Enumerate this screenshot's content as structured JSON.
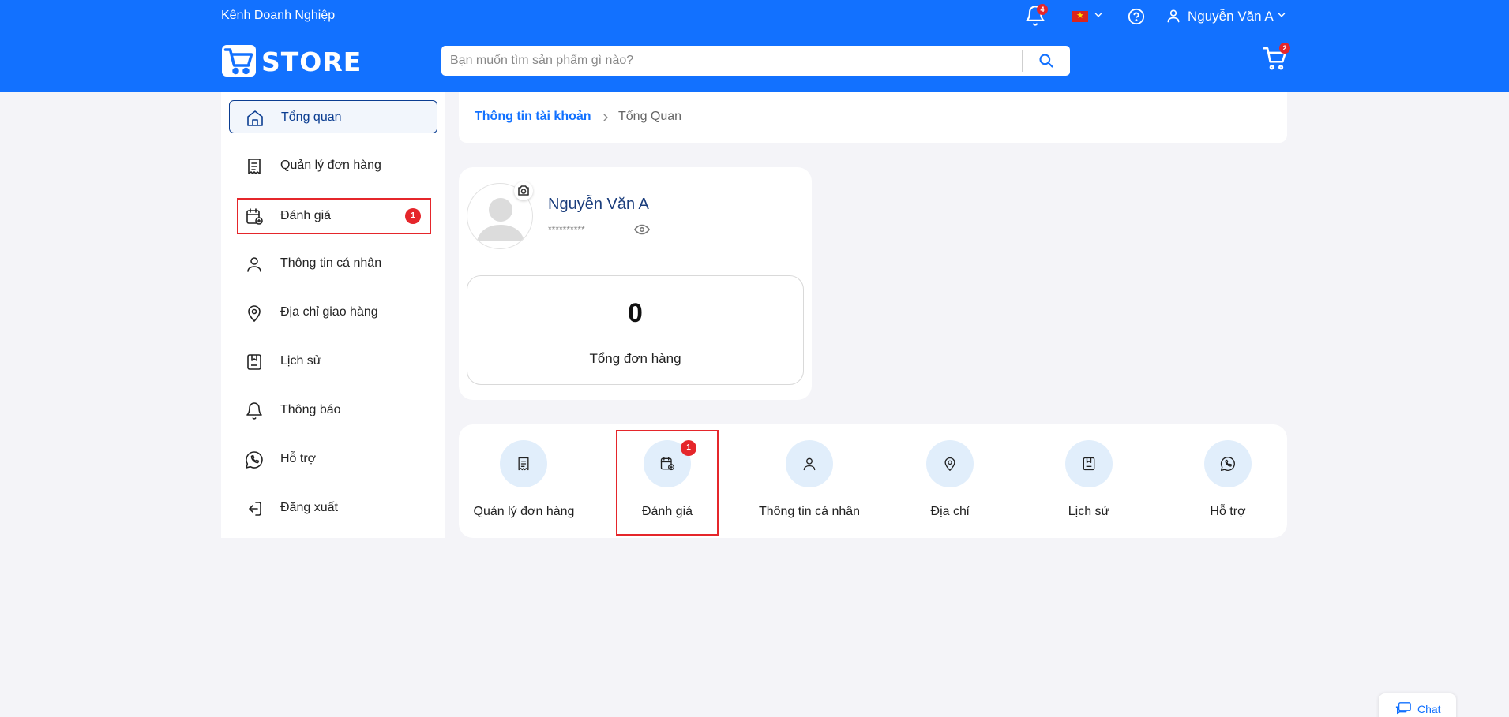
{
  "header": {
    "business_link": "Kênh Doanh Nghiệp",
    "notification_count": "4",
    "language_flag": "vietnam-flag",
    "user_name": "Nguyễn Văn A",
    "brand_color": "#1271ff",
    "logo_text": "STORE",
    "search_placeholder": "Bạn muốn tìm sản phẩm gì nào?",
    "cart_count": "2"
  },
  "sidebar": {
    "items": [
      {
        "label": "Tổng quan",
        "icon": "home-icon",
        "active": true
      },
      {
        "label": "Quản lý đơn hàng",
        "icon": "receipt-icon"
      },
      {
        "label": "Đánh giá",
        "icon": "calendar-review-icon",
        "badge": "1",
        "highlighted": true
      },
      {
        "label": "Thông tin cá nhân",
        "icon": "user-icon"
      },
      {
        "label": "Địa chỉ giao hàng",
        "icon": "location-pin-icon"
      },
      {
        "label": "Lịch sử",
        "icon": "history-bookmark-icon"
      },
      {
        "label": "Thông báo",
        "icon": "bell-icon"
      },
      {
        "label": "Hỗ trợ",
        "icon": "phone-support-icon"
      },
      {
        "label": "Đăng xuất",
        "icon": "logout-icon"
      }
    ]
  },
  "breadcrumb": {
    "parent": "Thông tin tài khoản",
    "current": "Tổng Quan"
  },
  "profile": {
    "name": "Nguyễn Văn A",
    "masked_password": "**********",
    "total_orders": "0",
    "total_orders_label": "Tổng đơn hàng"
  },
  "shortcuts": [
    {
      "label": "Quản lý đơn hàng",
      "icon": "receipt-icon"
    },
    {
      "label": "Đánh giá",
      "icon": "calendar-review-icon",
      "badge": "1",
      "highlighted": true
    },
    {
      "label": "Thông tin cá nhân",
      "icon": "user-icon"
    },
    {
      "label": "Địa chỉ",
      "icon": "location-pin-icon"
    },
    {
      "label": "Lịch sử",
      "icon": "history-bookmark-icon"
    },
    {
      "label": "Hỗ trợ",
      "icon": "phone-support-icon"
    }
  ],
  "chat": {
    "label": "Chat"
  },
  "colors": {
    "highlight": "#e5262b",
    "accent_dark": "#0b3d91",
    "badge": "#e5262b"
  }
}
